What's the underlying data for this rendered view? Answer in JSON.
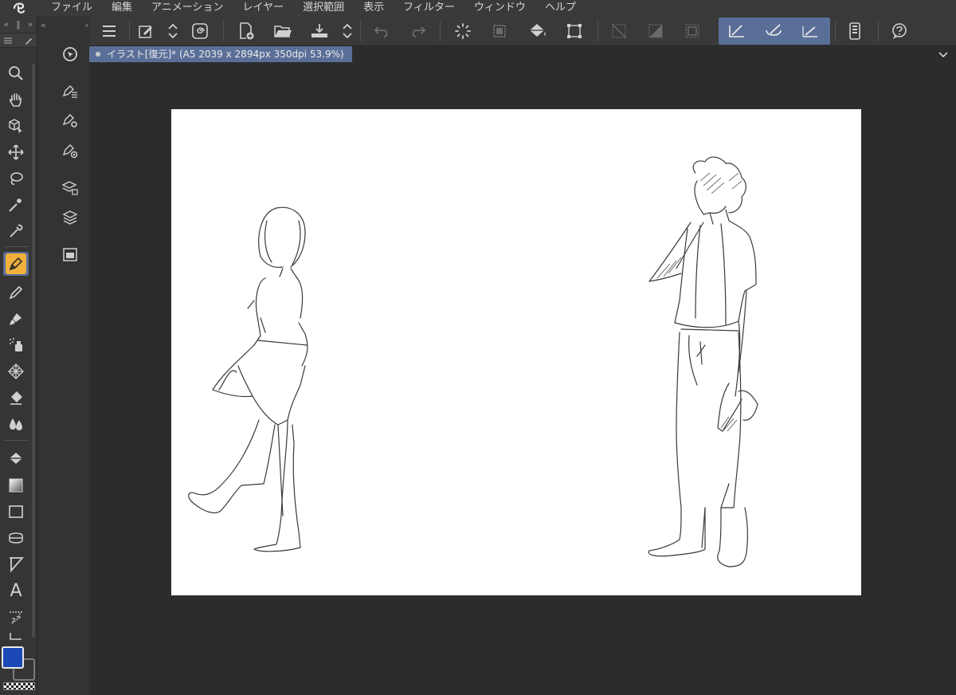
{
  "app": {
    "logo_icon": "clip-studio-logo-icon"
  },
  "menubar": {
    "items": [
      "ファイル",
      "編集",
      "アニメーション",
      "レイヤー",
      "選択範囲",
      "表示",
      "フィルター",
      "ウィンドウ",
      "ヘルプ"
    ]
  },
  "left_strip": {
    "collapse_left": "«",
    "collapse_right": "»",
    "collapse_left2": "«",
    "collapse_right2": "›",
    "tools": [
      "zoom-icon",
      "hand-icon",
      "object-select-icon",
      "move-icon",
      "lasso-icon",
      "auto-select-wand-icon",
      "eyedropper-icon",
      "pen-icon",
      "pencil-icon",
      "brush-icon",
      "airbrush-icon",
      "decoration-icon",
      "eraser-icon",
      "blend-icon",
      "fill-icon",
      "gradient-icon",
      "rectangle-figure-icon",
      "ruler-icon",
      "frame-border-icon",
      "text-icon",
      "balloon-icon",
      "correct-line-icon"
    ],
    "active_tool": "pen-icon",
    "text_tool_label": "A",
    "main_color": "#1a49b5",
    "sub_color": "#353535"
  },
  "sub_strip": {
    "tools": [
      "sub-tool-select-icon",
      "pen-sub-tool-list-icon",
      "pen-settings-icon",
      "pen-preset-icon",
      "layer-property-icon",
      "layer-stack-icon",
      "material-folder-icon"
    ]
  },
  "commandbar": {
    "buttons": [
      "menu-icon",
      "edit-layer-icon",
      "updown-icon",
      "spiral-icon",
      "new-file-icon",
      "open-file-icon",
      "save-icon",
      "updown2-icon",
      "undo-icon",
      "redo-icon",
      "loading-icon",
      "select-clear-icon",
      "fill-bucket-icon",
      "transform-icon",
      "deselect-icon",
      "invert-select-icon",
      "select-border-icon",
      "snap-ruler-icon",
      "snap-special-ruler-icon",
      "snap-grid-icon",
      "smartphone-icon",
      "help-icon"
    ]
  },
  "tabbar": {
    "document_tab": "イラスト[復元]* (A5 2039 x 2894px 350dpi 53.9%)"
  },
  "canvas": {
    "paper_color": "#ffffff",
    "background_color": "#2c2c2c"
  },
  "accent": "#5a6f98",
  "active_tool_color": "#f0b03c"
}
